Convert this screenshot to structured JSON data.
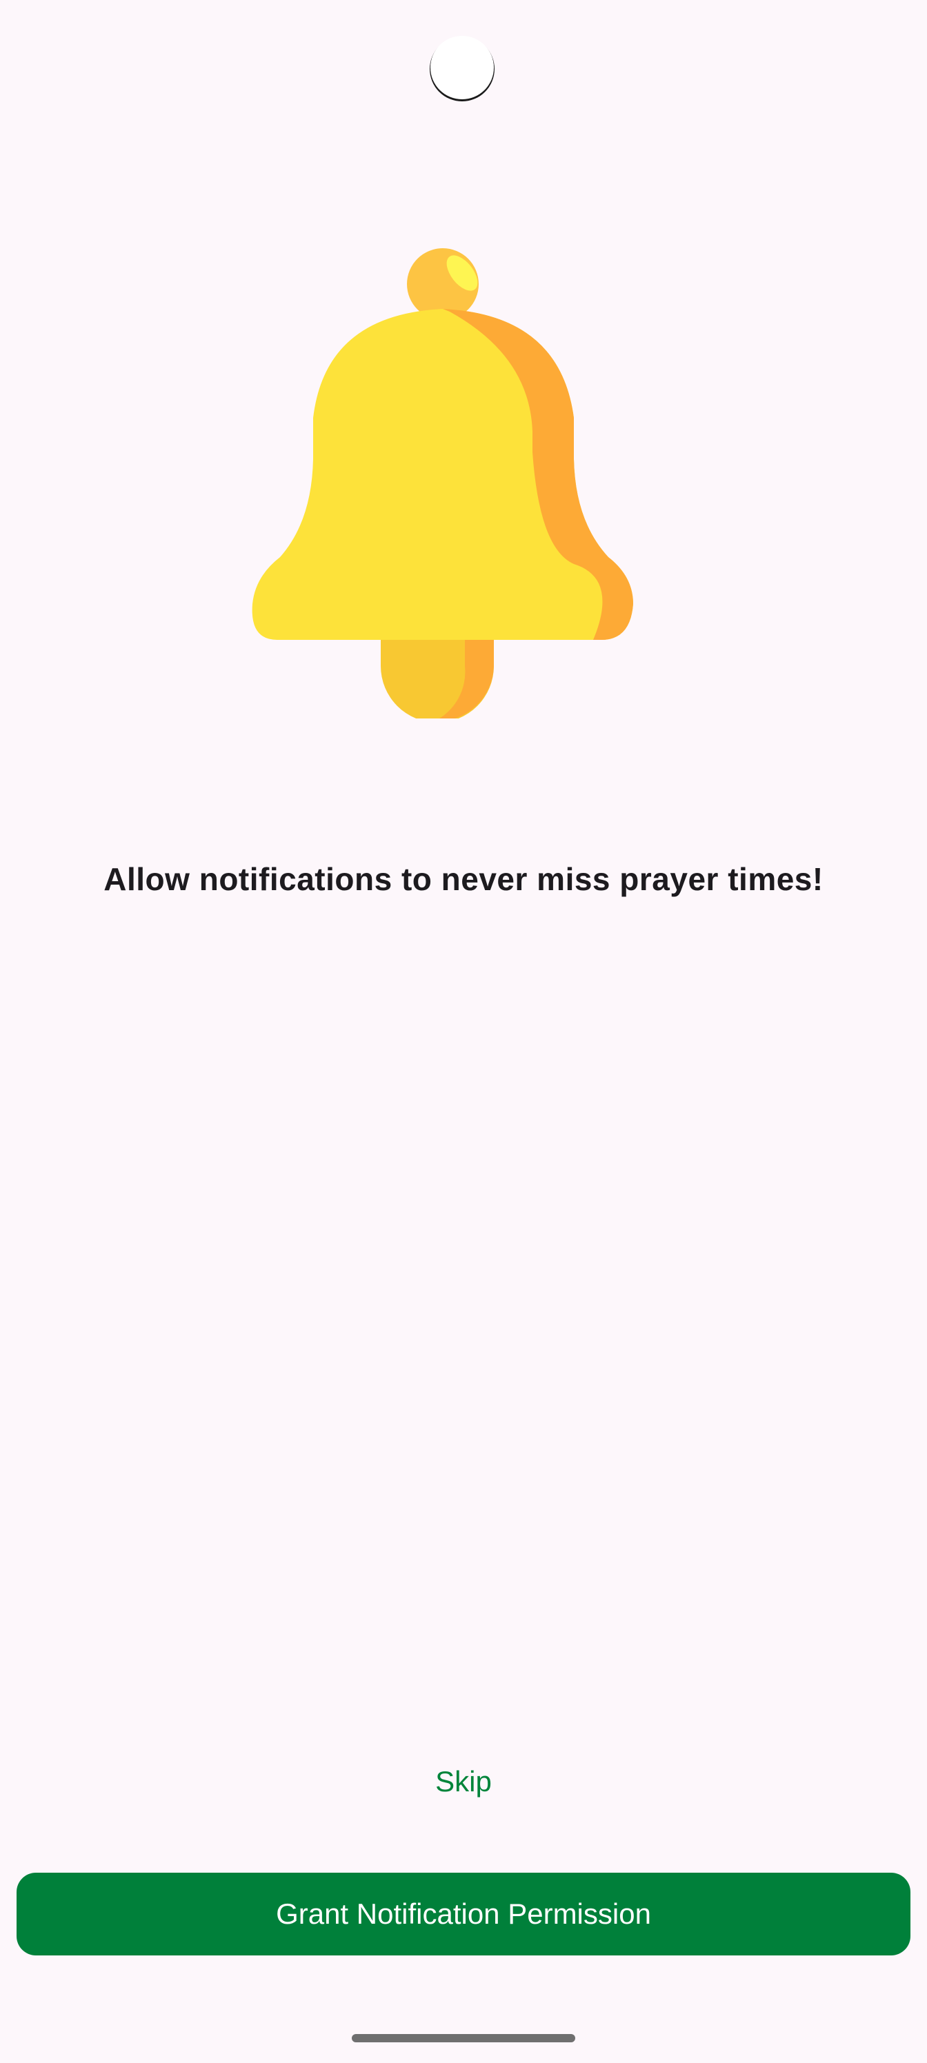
{
  "onboarding": {
    "headline": "Allow notifications to never miss prayer times!",
    "skip_label": "Skip",
    "grant_label": "Grant Notification Permission"
  },
  "icons": {
    "illustration": "bell-icon"
  },
  "colors": {
    "background": "#fdf7fb",
    "primary": "#00803a",
    "skip_text": "#00843a",
    "headline_text": "#1d1b1f",
    "bell_body": "#fde23a",
    "bell_shade": "#fdaa36",
    "bell_top": "#fdc443",
    "bell_clapper": "#f8c832"
  }
}
